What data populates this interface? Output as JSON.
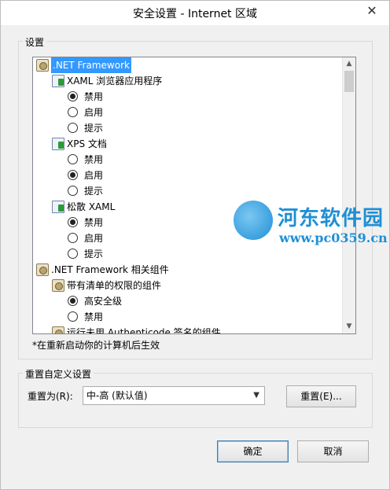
{
  "window": {
    "title": "安全设置 - Internet 区域",
    "close_glyph": "✕"
  },
  "settings_group": {
    "label": "设置",
    "tree": [
      {
        "type": "node",
        "icon": "gear-icon",
        "label": ".NET Framework",
        "selected": true
      },
      {
        "type": "node",
        "icon": "clip-icon",
        "label": "XAML 浏览器应用程序"
      },
      {
        "type": "radio",
        "label": "禁用",
        "checked": true
      },
      {
        "type": "radio",
        "label": "启用",
        "checked": false
      },
      {
        "type": "radio",
        "label": "提示",
        "checked": false
      },
      {
        "type": "node",
        "icon": "clip-icon",
        "label": "XPS 文档"
      },
      {
        "type": "radio",
        "label": "禁用",
        "checked": false
      },
      {
        "type": "radio",
        "label": "启用",
        "checked": true
      },
      {
        "type": "radio",
        "label": "提示",
        "checked": false
      },
      {
        "type": "node",
        "icon": "clip-icon",
        "label": "松散 XAML"
      },
      {
        "type": "radio",
        "label": "禁用",
        "checked": true
      },
      {
        "type": "radio",
        "label": "启用",
        "checked": false
      },
      {
        "type": "radio",
        "label": "提示",
        "checked": false
      },
      {
        "type": "node",
        "icon": "gear-icon",
        "label": ".NET Framework 相关组件"
      },
      {
        "type": "node",
        "icon": "gear-icon",
        "label": "带有清单的权限的组件"
      },
      {
        "type": "radio",
        "label": "高安全级",
        "checked": true
      },
      {
        "type": "radio",
        "label": "禁用",
        "checked": false
      },
      {
        "type": "node",
        "icon": "gear-icon",
        "label": "运行未用 Authenticode 签名的组件"
      }
    ],
    "note": "*在重新启动你的计算机后生效"
  },
  "reset_group": {
    "label": "重置自定义设置",
    "reset_to_label": "重置为(R):",
    "combo_value": "中-高 (默认值)",
    "reset_button": "重置(E)..."
  },
  "buttons": {
    "ok": "确定",
    "cancel": "取消"
  },
  "watermark": {
    "title": "河东软件园",
    "url": "www.pc0359.cn"
  }
}
